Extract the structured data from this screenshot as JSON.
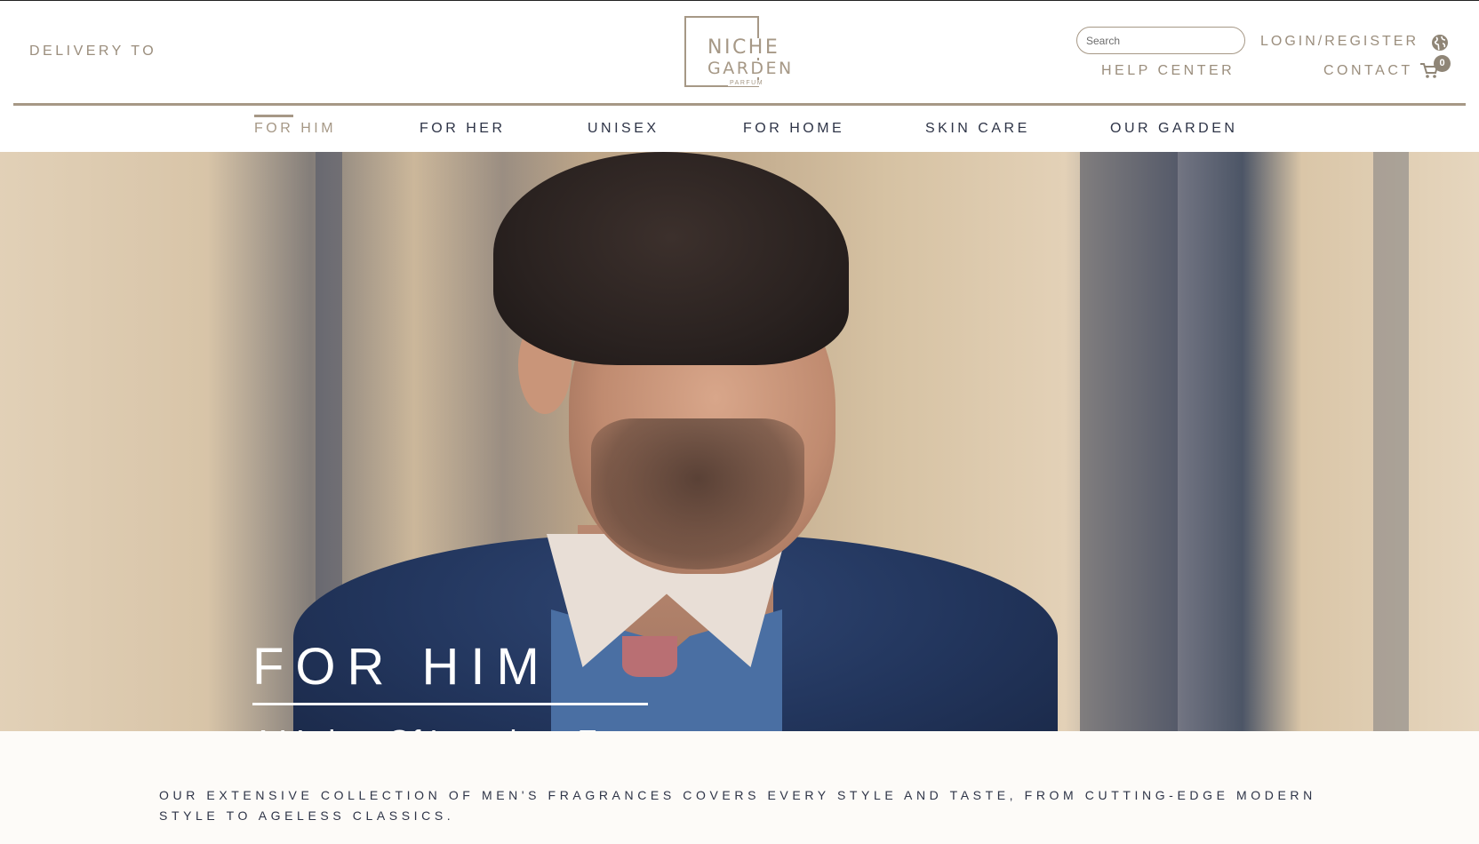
{
  "header": {
    "delivery_label": "DELIVERY TO",
    "logo": {
      "line1": "NICHE",
      "line2": "GARDEN",
      "line3": "PARFUM"
    },
    "search_placeholder": "Search",
    "login_label": "LOGIN/REGISTER",
    "help_label": "HELP CENTER",
    "contact_label": "CONTACT",
    "cart_count": "0",
    "icons": {
      "globe": "globe-icon",
      "cart": "cart-icon"
    }
  },
  "nav": {
    "items": [
      {
        "label": "FOR HIM",
        "active": true
      },
      {
        "label": "FOR HER",
        "active": false
      },
      {
        "label": "UNISEX",
        "active": false
      },
      {
        "label": "FOR HOME",
        "active": false
      },
      {
        "label": "SKIN CARE",
        "active": false
      },
      {
        "label": "OUR GARDEN",
        "active": false
      }
    ]
  },
  "hero": {
    "title": "FOR HIM",
    "subtitle": "A Variety Of Luxurious Fragrances"
  },
  "intro": {
    "text": "OUR EXTENSIVE COLLECTION OF MEN'S FRAGRANCES COVERS EVERY STYLE AND TASTE, FROM CUTTING-EDGE MODERN STYLE TO AGELESS CLASSICS."
  },
  "colors": {
    "accent": "#a69886",
    "text_dark": "#2e3447",
    "background": "#fdfbf8"
  }
}
